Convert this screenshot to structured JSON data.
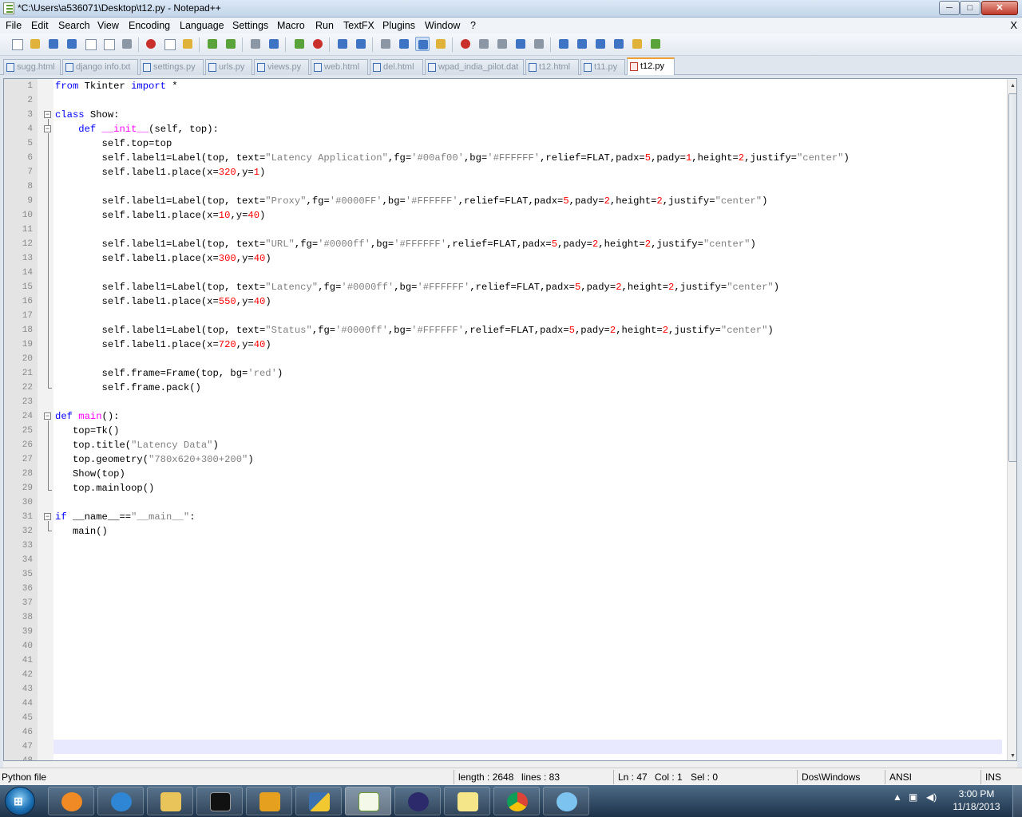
{
  "window": {
    "title": "*C:\\Users\\a536071\\Desktop\\t12.py - Notepad++",
    "min": "─",
    "max": "□",
    "close": "✕"
  },
  "menu": {
    "items": [
      "File",
      "Edit",
      "Search",
      "View",
      "Encoding",
      "Language",
      "Settings",
      "Macro",
      "Run",
      "TextFX",
      "Plugins",
      "Window",
      "?"
    ],
    "close": "X"
  },
  "toolbar": {
    "icons": [
      "new-file",
      "open-file",
      "save",
      "save-all",
      "close",
      "close-all",
      "print",
      "cut",
      "copy",
      "paste",
      "undo",
      "redo",
      "find",
      "replace",
      "zoom-in",
      "zoom-out",
      "sync-vertical",
      "sync-horizontal",
      "word-wrap",
      "show-all-characters",
      "indent-guide",
      "user-defined-dialog",
      "record-macro",
      "stop-recording",
      "playback-macro",
      "run-macro-multiple",
      "save-macro",
      "collapse-all",
      "move-up",
      "move-down",
      "jump",
      "launch-browser",
      "spell-check"
    ]
  },
  "tabs": [
    "sugg.html",
    "django info.txt",
    "settings.py",
    "urls.py",
    "views.py",
    "web.html",
    "del.html",
    "wpad_india_pilot.dat",
    "t12.html",
    "t11.py",
    "t12.py"
  ],
  "active_tab": "t12.py",
  "editor": {
    "line_numbers": [
      "1",
      "2",
      "3",
      "4",
      "5",
      "6",
      "7",
      "8",
      "9",
      "10",
      "11",
      "12",
      "13",
      "14",
      "15",
      "16",
      "17",
      "18",
      "19",
      "20",
      "21",
      "22",
      "23",
      "24",
      "25",
      "26",
      "27",
      "28",
      "29",
      "30",
      "31",
      "32",
      "33",
      "34",
      "35",
      "36",
      "37",
      "38",
      "39",
      "40",
      "41",
      "42",
      "43",
      "44",
      "45",
      "46",
      "47",
      "48"
    ],
    "lines": [
      "from Tkinter import *",
      "",
      "class Show:",
      "    def __init__(self, top):",
      "        self.top=top",
      "        self.label1=Label(top, text=\"Latency Application\",fg='#00af00',bg='#FFFFFF',relief=FLAT,padx=5,pady=1,height=2,justify=\"center\")",
      "        self.label1.place(x=320,y=1)",
      "",
      "        self.label1=Label(top, text=\"Proxy\",fg='#0000FF',bg='#FFFFFF',relief=FLAT,padx=5,pady=2,height=2,justify=\"center\")",
      "        self.label1.place(x=10,y=40)",
      "",
      "        self.label1=Label(top, text=\"URL\",fg='#0000ff',bg='#FFFFFF',relief=FLAT,padx=5,pady=2,height=2,justify=\"center\")",
      "        self.label1.place(x=300,y=40)",
      "",
      "        self.label1=Label(top, text=\"Latency\",fg='#0000ff',bg='#FFFFFF',relief=FLAT,padx=5,pady=2,height=2,justify=\"center\")",
      "        self.label1.place(x=550,y=40)",
      "",
      "        self.label1=Label(top, text=\"Status\",fg='#0000ff',bg='#FFFFFF',relief=FLAT,padx=5,pady=2,height=2,justify=\"center\")",
      "        self.label1.place(x=720,y=40)",
      "",
      "        self.frame=Frame(top, bg='red')",
      "        self.frame.pack()",
      "",
      "def main():",
      "   top=Tk()",
      "   top.title(\"Latency Data\")",
      "   top.geometry(\"780x620+300+200\")",
      "   Show(top)",
      "   top.mainloop()",
      "",
      "if __name__==\"__main__\":",
      "   main()"
    ]
  },
  "status": {
    "type": "Python file",
    "length": "length : 2648",
    "lines": "lines : 83",
    "ln": "Ln : 47",
    "col": "Col : 1",
    "sel": "Sel : 0",
    "eol": "Dos\\Windows",
    "encoding": "ANSI",
    "mode": "INS"
  },
  "taskbar": {
    "start_label": "⊞",
    "apps": [
      "chat-app-icon",
      "internet-explorer-icon",
      "windows-explorer-icon",
      "command-prompt-icon",
      "outlook-icon",
      "python-icon",
      "notepad-plus-plus-icon",
      "eclipse-icon",
      "sticky-notes-icon",
      "chrome-icon",
      "communicator-icon"
    ],
    "active_app": "notepad-plus-plus-icon",
    "time": "3:00 PM",
    "date": "11/18/2013"
  },
  "colors": {
    "keyword": "#0000ff",
    "function": "#ff00ff",
    "string": "#808080",
    "number": "#ff0000",
    "caret_line": "#e8e8ff",
    "accent_tab": "#f0a030"
  }
}
